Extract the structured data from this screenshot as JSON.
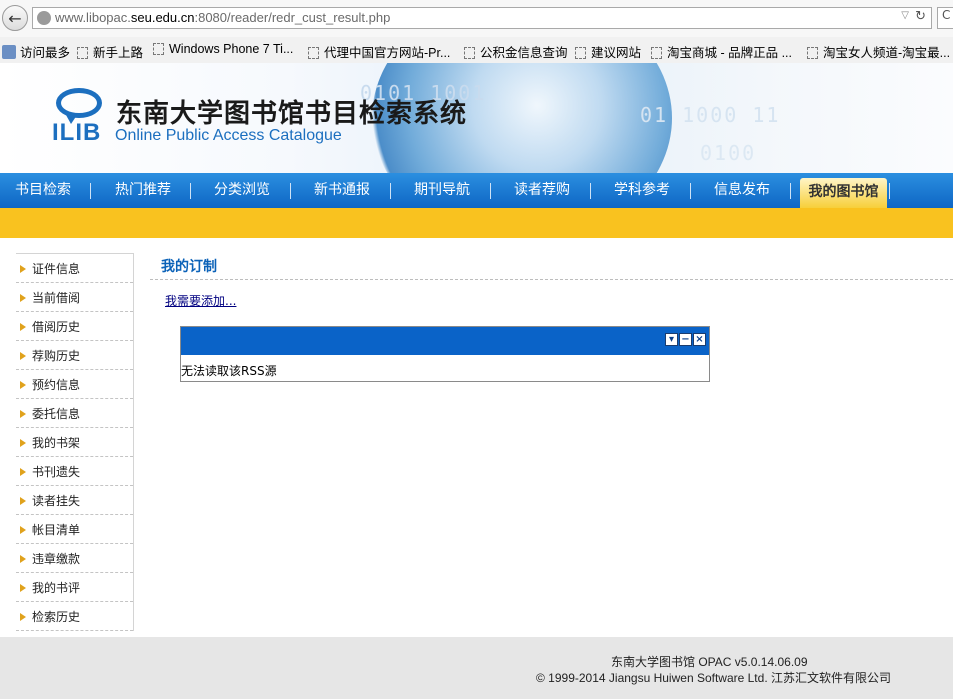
{
  "browser": {
    "url_pre": "www.libopac.",
    "url_host": "seu.edu.cn",
    "url_post": ":8080/reader/redr_cust_result.php",
    "bookmarks": [
      "访问最多",
      "新手上路",
      "Windows Phone 7 Ti...",
      "代理中国官方网站-Pr...",
      "公积金信息查询",
      "建议网站",
      "淘宝商城 - 品牌正品 ...",
      "淘宝女人频道-淘宝最..."
    ]
  },
  "header": {
    "logo_text": "ILIB",
    "title": "东南大学图书馆书目检索系统",
    "subtitle": "Online Public Access Catalogue"
  },
  "nav": {
    "items": [
      "书目检索",
      "热门推荐",
      "分类浏览",
      "新书通报",
      "期刊导航",
      "读者荐购",
      "学科参考",
      "信息发布",
      "我的图书馆"
    ],
    "active_index": 8
  },
  "sidebar": {
    "items": [
      "证件信息",
      "当前借阅",
      "借阅历史",
      "荐购历史",
      "预约信息",
      "委托信息",
      "我的书架",
      "书刊遗失",
      "读者挂失",
      "帐目清单",
      "违章缴款",
      "我的书评",
      "检索历史"
    ]
  },
  "main": {
    "title": "我的订制",
    "add_link": "我需要添加...",
    "rss_message": "无法读取该RSS源"
  },
  "footer": {
    "line1": "东南大学图书馆   OPAC v5.0.14.06.09",
    "line2": "© 1999-2014 Jiangsu Huiwen Software Ltd. 江苏汇文软件有限公司"
  },
  "colors": {
    "nav_blue": "#0e66c4",
    "accent_yellow": "#f9c21f",
    "title_blue": "#0b62b8"
  }
}
